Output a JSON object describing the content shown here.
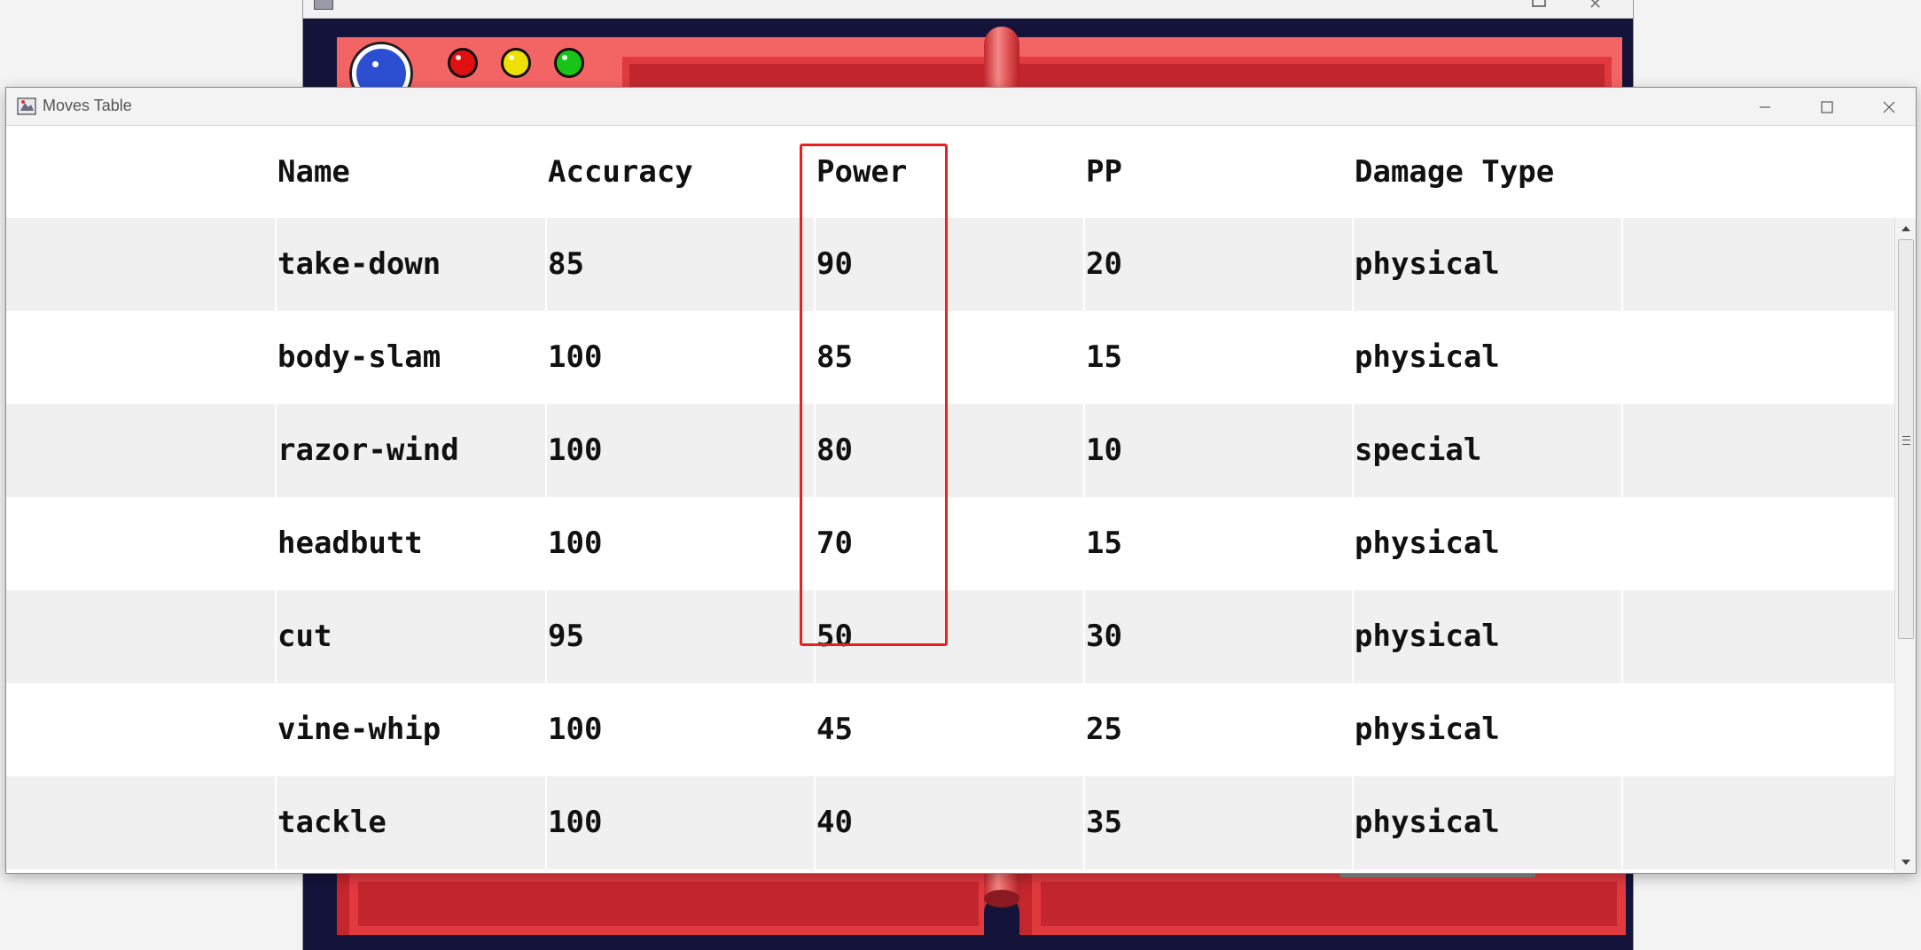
{
  "window": {
    "title": "Moves Table",
    "controls": [
      "minimize",
      "maximize",
      "close"
    ]
  },
  "table": {
    "columns": [
      "Name",
      "Accuracy",
      "Power",
      "PP",
      "Damage Type"
    ],
    "highlighted_column": "Power",
    "highlight_color": "#e8201e",
    "rows": [
      {
        "name": "take-down",
        "accuracy": "85",
        "power": "90",
        "pp": "20",
        "damage_type": "physical"
      },
      {
        "name": "body-slam",
        "accuracy": "100",
        "power": "85",
        "pp": "15",
        "damage_type": "physical"
      },
      {
        "name": "razor-wind",
        "accuracy": "100",
        "power": "80",
        "pp": "10",
        "damage_type": "special"
      },
      {
        "name": "headbutt",
        "accuracy": "100",
        "power": "70",
        "pp": "15",
        "damage_type": "physical"
      },
      {
        "name": "cut",
        "accuracy": "95",
        "power": "50",
        "pp": "30",
        "damage_type": "physical"
      },
      {
        "name": "vine-whip",
        "accuracy": "100",
        "power": "45",
        "pp": "25",
        "damage_type": "physical"
      },
      {
        "name": "tackle",
        "accuracy": "100",
        "power": "40",
        "pp": "35",
        "damage_type": "physical"
      }
    ]
  },
  "scrollbar": {
    "visible_fraction": 0.65,
    "position": 0.0
  },
  "background_app": {
    "lights": [
      "blue",
      "red",
      "yellow",
      "green"
    ],
    "colors": {
      "body": "#f36565",
      "dark": "#c4262e",
      "screen": "#14133a"
    }
  }
}
